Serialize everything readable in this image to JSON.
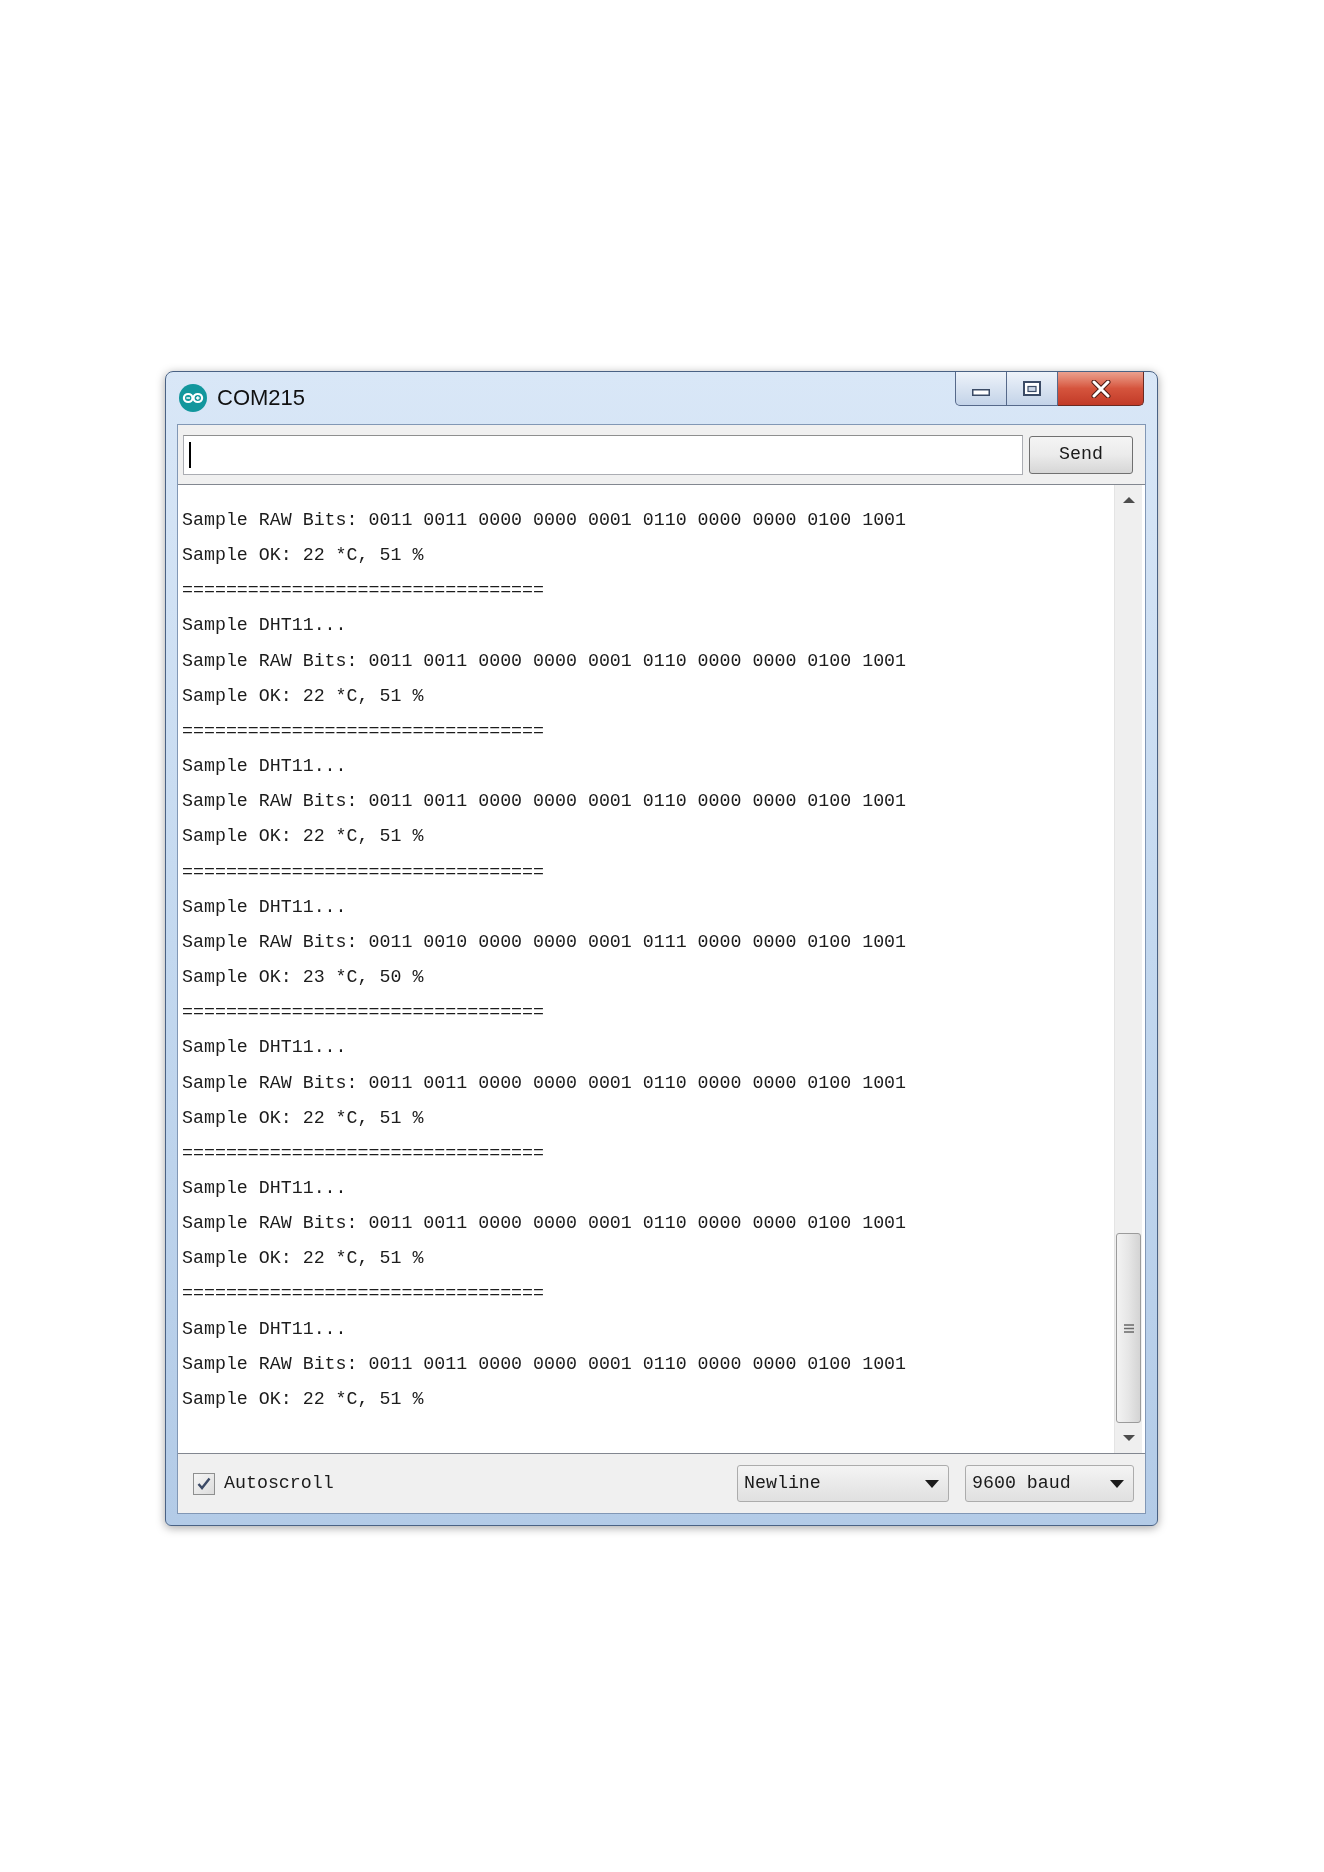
{
  "window": {
    "title": "COM215"
  },
  "toolbar": {
    "send_button": "Send"
  },
  "output": {
    "lines": [
      "Sample RAW Bits: 0011 0011 0000 0000 0001 0110 0000 0000 0100 1001",
      "Sample OK: 22 *C, 51 %",
      "=================================",
      "Sample DHT11...",
      "Sample RAW Bits: 0011 0011 0000 0000 0001 0110 0000 0000 0100 1001",
      "Sample OK: 22 *C, 51 %",
      "=================================",
      "Sample DHT11...",
      "Sample RAW Bits: 0011 0011 0000 0000 0001 0110 0000 0000 0100 1001",
      "Sample OK: 22 *C, 51 %",
      "=================================",
      "Sample DHT11...",
      "Sample RAW Bits: 0011 0010 0000 0000 0001 0111 0000 0000 0100 1001",
      "Sample OK: 23 *C, 50 %",
      "=================================",
      "Sample DHT11...",
      "Sample RAW Bits: 0011 0011 0000 0000 0001 0110 0000 0000 0100 1001",
      "Sample OK: 22 *C, 51 %",
      "=================================",
      "Sample DHT11...",
      "Sample RAW Bits: 0011 0011 0000 0000 0001 0110 0000 0000 0100 1001",
      "Sample OK: 22 *C, 51 %",
      "=================================",
      "Sample DHT11...",
      "Sample RAW Bits: 0011 0011 0000 0000 0001 0110 0000 0000 0100 1001",
      "Sample OK: 22 *C, 51 %"
    ]
  },
  "footer": {
    "autoscroll": {
      "label": "Autoscroll",
      "checked": true
    },
    "line_ending": "Newline",
    "baud_rate": "9600 baud"
  }
}
